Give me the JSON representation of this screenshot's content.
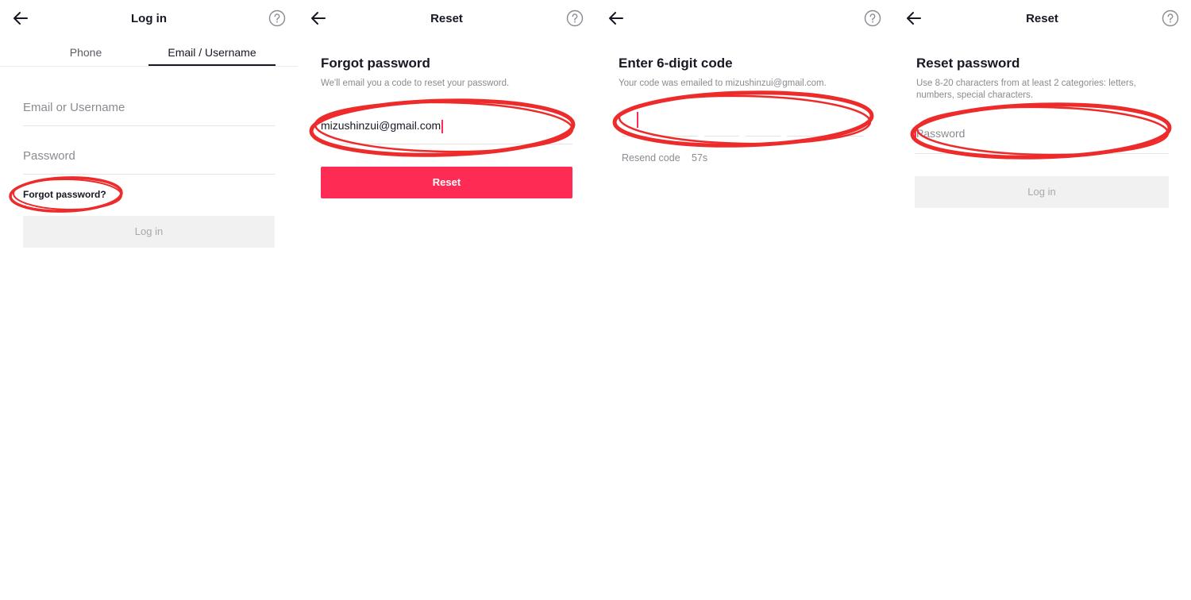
{
  "screens": [
    {
      "title": "Log in",
      "tabs": [
        "Phone",
        "Email / Username"
      ],
      "email_placeholder": "Email or Username",
      "password_placeholder": "Password",
      "forgot_label": "Forgot password?",
      "login_label": "Log in"
    },
    {
      "title": "Reset",
      "heading": "Forgot password",
      "subtext": "We'll email you a code to reset your password.",
      "email_value": "mizushinzui@gmail.com",
      "reset_label": "Reset"
    },
    {
      "title": "",
      "heading": "Enter 6-digit code",
      "subtext": "Your code was emailed to mizushinzui@gmail.com.",
      "resend_label": "Resend code",
      "timer": "57s"
    },
    {
      "title": "Reset",
      "heading": "Reset password",
      "subtext": "Use 8-20 characters from at least 2 categories: letters, numbers, special characters.",
      "password_placeholder": "Password",
      "login_label": "Log in"
    }
  ],
  "icons": {
    "back": "arrow-left-icon",
    "help": "question-circle-icon"
  },
  "colors": {
    "accent": "#fe2c55",
    "annotation": "#ee2b2b",
    "disabled_bg": "#f1f1f2",
    "text": "#161823",
    "muted": "#8a8b91"
  }
}
